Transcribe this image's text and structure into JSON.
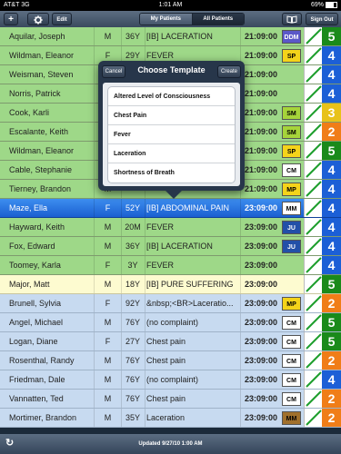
{
  "status_bar": {
    "carrier": "AT&T",
    "network": "3G",
    "time": "1:01 AM",
    "battery": "69%"
  },
  "toolbar": {
    "add_label": "+",
    "settings_icon": "gear-icon",
    "edit_label": "Edit",
    "tabs": [
      {
        "label": "My Patients"
      },
      {
        "label": "All Patients"
      }
    ],
    "book_icon": "book-icon",
    "signout_label": "Sign Out"
  },
  "patients": [
    {
      "name": "Aquilar, Joseph",
      "sex": "M",
      "age": "36Y",
      "complaint": "[IB] LACERATION",
      "time": "21:09:00",
      "provider": "DDM",
      "provider_color": "#5b58c8",
      "provider_text": "#ffffff",
      "esi": "5",
      "esi_color": "#1a8a1a",
      "row": "green"
    },
    {
      "name": "Wildman, Eleanor",
      "sex": "F",
      "age": "29Y",
      "complaint": "FEVER",
      "time": "21:09:00",
      "provider": "SP",
      "provider_color": "#f4d31a",
      "provider_text": "#000000",
      "esi": "4",
      "esi_color": "#1c5fd6",
      "row": "green"
    },
    {
      "name": "Weisman, Steven",
      "sex": "M",
      "age": "76Y",
      "complaint": "FEVER",
      "time": "21:09:00",
      "provider": "",
      "provider_color": "",
      "provider_text": "",
      "esi": "4",
      "esi_color": "#1c5fd6",
      "row": "green"
    },
    {
      "name": "Norris, Patrick",
      "sex": "M",
      "age": "32Y",
      "complaint": "[IB] LACERATION",
      "time": "21:09:00",
      "provider": "",
      "provider_color": "",
      "provider_text": "",
      "esi": "4",
      "esi_color": "#1c5fd6",
      "row": "green"
    },
    {
      "name": "Cook, Karli",
      "sex": "F",
      "age": "",
      "complaint": "",
      "time": "21:09:00",
      "provider": "SM",
      "provider_color": "#a6d43a",
      "provider_text": "#000000",
      "esi": "3",
      "esi_color": "#e8c21a",
      "row": "green"
    },
    {
      "name": "Escalante, Keith",
      "sex": "M",
      "age": "",
      "complaint": "",
      "time": "21:09:00",
      "provider": "SM",
      "provider_color": "#a6d43a",
      "provider_text": "#000000",
      "esi": "2",
      "esi_color": "#f07d18",
      "row": "green"
    },
    {
      "name": "Wildman, Eleanor",
      "sex": "F",
      "age": "",
      "complaint": "",
      "time": "21:09:00",
      "provider": "SP",
      "provider_color": "#f4d31a",
      "provider_text": "#000000",
      "esi": "5",
      "esi_color": "#1a8a1a",
      "row": "green"
    },
    {
      "name": "Cable, Stephanie",
      "sex": "F",
      "age": "",
      "complaint": "",
      "time": "21:09:00",
      "provider": "CM",
      "provider_color": "#ffffff",
      "provider_text": "#000000",
      "esi": "4",
      "esi_color": "#1c5fd6",
      "row": "green"
    },
    {
      "name": "Tierney, Brandon",
      "sex": "M",
      "age": "",
      "complaint": "",
      "time": "21:09:00",
      "provider": "MP",
      "provider_color": "#f4d31a",
      "provider_text": "#000000",
      "esi": "4",
      "esi_color": "#1c5fd6",
      "row": "green"
    },
    {
      "name": "Maze, Ella",
      "sex": "F",
      "age": "52Y",
      "complaint": "[IB] ABDOMINAL PAIN",
      "time": "23:09:00",
      "provider": "MM",
      "provider_color": "#ffffff",
      "provider_text": "#000000",
      "esi": "4",
      "esi_color": "#1c5fd6",
      "row": "sel"
    },
    {
      "name": "Hayward, Keith",
      "sex": "M",
      "age": "20M",
      "complaint": "FEVER",
      "time": "23:09:00",
      "provider": "JU",
      "provider_color": "#2250a8",
      "provider_text": "#ffffff",
      "esi": "4",
      "esi_color": "#1c5fd6",
      "row": "green"
    },
    {
      "name": "Fox, Edward",
      "sex": "M",
      "age": "36Y",
      "complaint": "[IB] LACERATION",
      "time": "23:09:00",
      "provider": "JU",
      "provider_color": "#2250a8",
      "provider_text": "#ffffff",
      "esi": "4",
      "esi_color": "#1c5fd6",
      "row": "green"
    },
    {
      "name": "Toomey, Karla",
      "sex": "F",
      "age": "3Y",
      "complaint": "FEVER",
      "time": "23:09:00",
      "provider": "",
      "provider_color": "",
      "provider_text": "",
      "esi": "4",
      "esi_color": "#1c5fd6",
      "row": "green"
    },
    {
      "name": "Major, Matt",
      "sex": "M",
      "age": "18Y",
      "complaint": "[IB] PURE SUFFERING",
      "time": "23:09:00",
      "provider": "",
      "provider_color": "",
      "provider_text": "",
      "esi": "5",
      "esi_color": "#1a8a1a",
      "row": "yellow"
    },
    {
      "name": "Brunell, Sylvia",
      "sex": "F",
      "age": "92Y",
      "complaint": "&nbsp;<BR>Laceratio...",
      "time": "23:09:00",
      "provider": "MP",
      "provider_color": "#f4d31a",
      "provider_text": "#000000",
      "esi": "2",
      "esi_color": "#f07d18",
      "row": "blue"
    },
    {
      "name": "Angel, Michael",
      "sex": "M",
      "age": "76Y",
      "complaint": "(no complaint)",
      "time": "23:09:00",
      "provider": "CM",
      "provider_color": "#ffffff",
      "provider_text": "#000000",
      "esi": "5",
      "esi_color": "#1a8a1a",
      "row": "blue"
    },
    {
      "name": "Logan, Diane",
      "sex": "F",
      "age": "27Y",
      "complaint": "Chest pain",
      "time": "23:09:00",
      "provider": "CM",
      "provider_color": "#ffffff",
      "provider_text": "#000000",
      "esi": "5",
      "esi_color": "#1a8a1a",
      "row": "blue"
    },
    {
      "name": "Rosenthal, Randy",
      "sex": "M",
      "age": "76Y",
      "complaint": "Chest pain",
      "time": "23:09:00",
      "provider": "CM",
      "provider_color": "#ffffff",
      "provider_text": "#000000",
      "esi": "2",
      "esi_color": "#f07d18",
      "row": "blue"
    },
    {
      "name": "Friedman, Dale",
      "sex": "M",
      "age": "76Y",
      "complaint": "(no complaint)",
      "time": "23:09:00",
      "provider": "CM",
      "provider_color": "#ffffff",
      "provider_text": "#000000",
      "esi": "4",
      "esi_color": "#1c5fd6",
      "row": "blue"
    },
    {
      "name": "Vannatten, Ted",
      "sex": "M",
      "age": "76Y",
      "complaint": "Chest pain",
      "time": "23:09:00",
      "provider": "CM",
      "provider_color": "#ffffff",
      "provider_text": "#000000",
      "esi": "2",
      "esi_color": "#f07d18",
      "row": "blue"
    },
    {
      "name": "Mortimer, Brandon",
      "sex": "M",
      "age": "35Y",
      "complaint": "Laceration",
      "time": "23:09:00",
      "provider": "MM",
      "provider_color": "#a0702c",
      "provider_text": "#000000",
      "esi": "2",
      "esi_color": "#f07d18",
      "row": "blue"
    }
  ],
  "popover": {
    "cancel_label": "Cancel",
    "title": "Choose Template",
    "create_label": "Create",
    "items": [
      {
        "label": "Altered Level of Consciousness"
      },
      {
        "label": "Chest Pain"
      },
      {
        "label": "Fever"
      },
      {
        "label": "Laceration"
      },
      {
        "label": "Shortness of Breath"
      }
    ]
  },
  "bottom_bar": {
    "updated_text": "Updated 9/27/10 1:00 AM",
    "refresh_icon": "refresh-icon"
  }
}
